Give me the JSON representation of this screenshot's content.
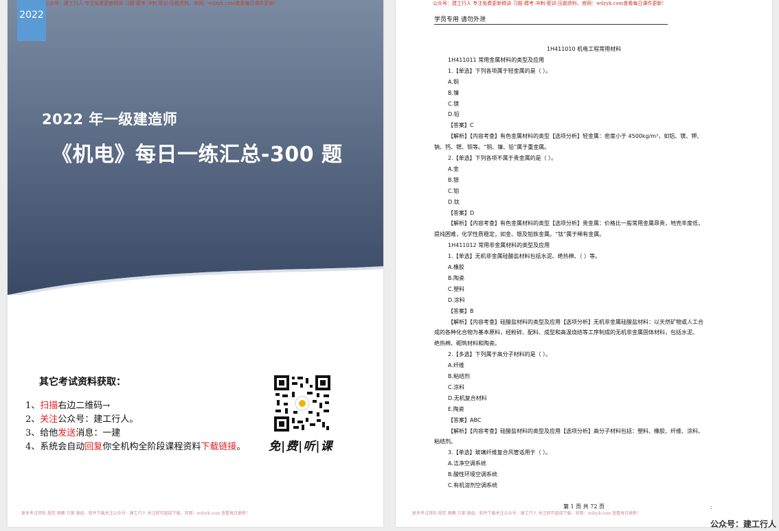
{
  "cover": {
    "watermark_top": "公众号：建工行人 专注免费更新精讲-习题-模考-冲刺-密训-压题资料，官网：wdzyk.com查看每日课件更新!",
    "year": "2022",
    "title_line1": "2022 年一级建造师",
    "title_line2": "《机电》每日一练汇总-300 题",
    "other_heading": "其它考试资料获取：",
    "steps": [
      {
        "prefix": "1、",
        "highlight": "扫描",
        "rest": "右边二维码→"
      },
      {
        "prefix": "2、",
        "highlight": "关注",
        "rest": "公众号：建工行人。"
      },
      {
        "prefix": "3、",
        "pre": "给他",
        "highlight": "发送",
        "rest": "消息：一建"
      },
      {
        "prefix": "4、",
        "pre": "系统会自动",
        "highlight": "回复",
        "mid": "你全机构全阶段课程资料",
        "highlight2": "下载链接",
        "rest": "。"
      }
    ],
    "free_listen": "免|费|听|课",
    "watermark_bottom": "更多考试资料 规范 图集 方案 施组、软件下载关注公众号：建工行人 关注即可直接下载，官网：wdzyk.com 查看每日更新!",
    "colors": {
      "banner_top": "#76869d",
      "banner_bottom": "#3e4f6b",
      "accent": "#5b9bd5",
      "highlight": "#e02020"
    }
  },
  "inner": {
    "watermark_top": "公众号：建工行人 专注免费更新精讲-习题-模考-冲刺-密训-压题资料，官网：wdzyk.com查看每日课件更新!",
    "header": "学员专用 请勿外泄",
    "lines": [
      {
        "t": "1H411010 机电工程常用材料",
        "c": true
      },
      {
        "t": "1H411011 常用金属材料的类型及应用"
      },
      {
        "t": "1.【单选】下列各项属于轻金属的是（    ）。"
      },
      {
        "t": "A.铜"
      },
      {
        "t": "B.镍"
      },
      {
        "t": "C.镁"
      },
      {
        "t": "D.铅"
      },
      {
        "t": "【答案】C"
      },
      {
        "t": "【解析】【内容考查】有色金属材料的类型【选项分析】轻金属：密度小于 4500kg/m³，如铝、镁、钾、"
      },
      {
        "t": "钠、钙、锶、钡等。“铜、镍、铅”属于重金属。",
        "f": true
      },
      {
        "t": "2.【单选】下列各项不属于贵金属的是（    ）。"
      },
      {
        "t": "A.金"
      },
      {
        "t": "B.银"
      },
      {
        "t": "C.铂"
      },
      {
        "t": "D.钛"
      },
      {
        "t": "【答案】D"
      },
      {
        "t": "【解析】【内容考查】有色金属材料的类型【选项分析】贵金属：价格比一般常用金属昂贵，地壳丰度低，"
      },
      {
        "t": "提纯困难，化学性质稳定，如金、银及铂族金属。“钛”属于稀有金属。",
        "f": true
      },
      {
        "t": "1H411012 常用非金属材料的类型及应用"
      },
      {
        "t": "1.【单选】无机非金属硅酸盐材料包括水泥、绝热棉、（    ）等。"
      },
      {
        "t": "A.橡胶"
      },
      {
        "t": "B.陶瓷"
      },
      {
        "t": "C.塑料"
      },
      {
        "t": "D.涂料"
      },
      {
        "t": "【答案】B"
      },
      {
        "t": "【解析】【内容考查】硅酸盐材料的类型及应用【选项分析】无机非金属硅酸盐材料：以天然矿物或人工合"
      },
      {
        "t": "成的各种化合物为基本原料，经粉碎、配料、成型和高温烧结等工序制成的无机非金属固体材料，包括水泥、",
        "f": true
      },
      {
        "t": "绝热棉、砌筑材料和陶瓷。",
        "f": true
      },
      {
        "t": "2.【多选】下列属于高分子材料的是（    ）。"
      },
      {
        "t": "A.纤维"
      },
      {
        "t": "B.粘结剂"
      },
      {
        "t": "C.涂料"
      },
      {
        "t": "D.无机复合材料"
      },
      {
        "t": "E.陶瓷"
      },
      {
        "t": "【答案】ABC"
      },
      {
        "t": "【解析】【内容考查】硅酸盐材料的类型及应用【选项分析】高分子材料包括：塑料、橡胶、纤维、涂料、"
      },
      {
        "t": "粘结剂。",
        "f": true
      },
      {
        "t": "3.【单选】玻璃纤维复合风管适用于（    ）。"
      },
      {
        "t": "A.洁净空调系统"
      },
      {
        "t": "B.酸性环境空调系统"
      },
      {
        "t": "C.有机溶剂空调系统"
      }
    ],
    "page_number": "第 1 页 共 72 页",
    "watermark_bottom": "更多考试资料 规范 图集 方案 施组、软件下载关注公众号：建工行人 关注即可直接下载，官网：wdzyk.com 查看每日更新!",
    "colon_mark": ":"
  },
  "outside_watermark": "公众号：建工行人"
}
